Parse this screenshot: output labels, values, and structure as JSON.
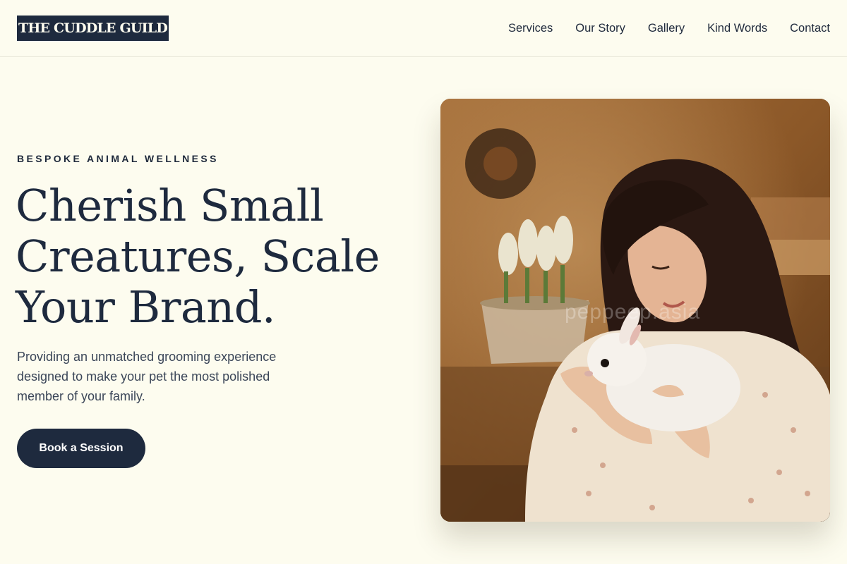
{
  "header": {
    "logo_text": "THE CUDDLE GUILD",
    "nav": [
      "Services",
      "Our Story",
      "Gallery",
      "Kind Words",
      "Contact"
    ]
  },
  "hero": {
    "eyebrow": "BESPOKE ANIMAL WELLNESS",
    "headline_lines": [
      "Cherish Small",
      "Creatures, Scale",
      "Your Brand."
    ],
    "lead": "Providing an unmatched grooming experience designed to make your pet the most polished member of your family.",
    "cta_label": "Book a Session",
    "image_watermark": "peppeep.asia"
  },
  "colors": {
    "background": "#fdfcef",
    "navy": "#1e2a3e",
    "text": "#1e293b"
  }
}
